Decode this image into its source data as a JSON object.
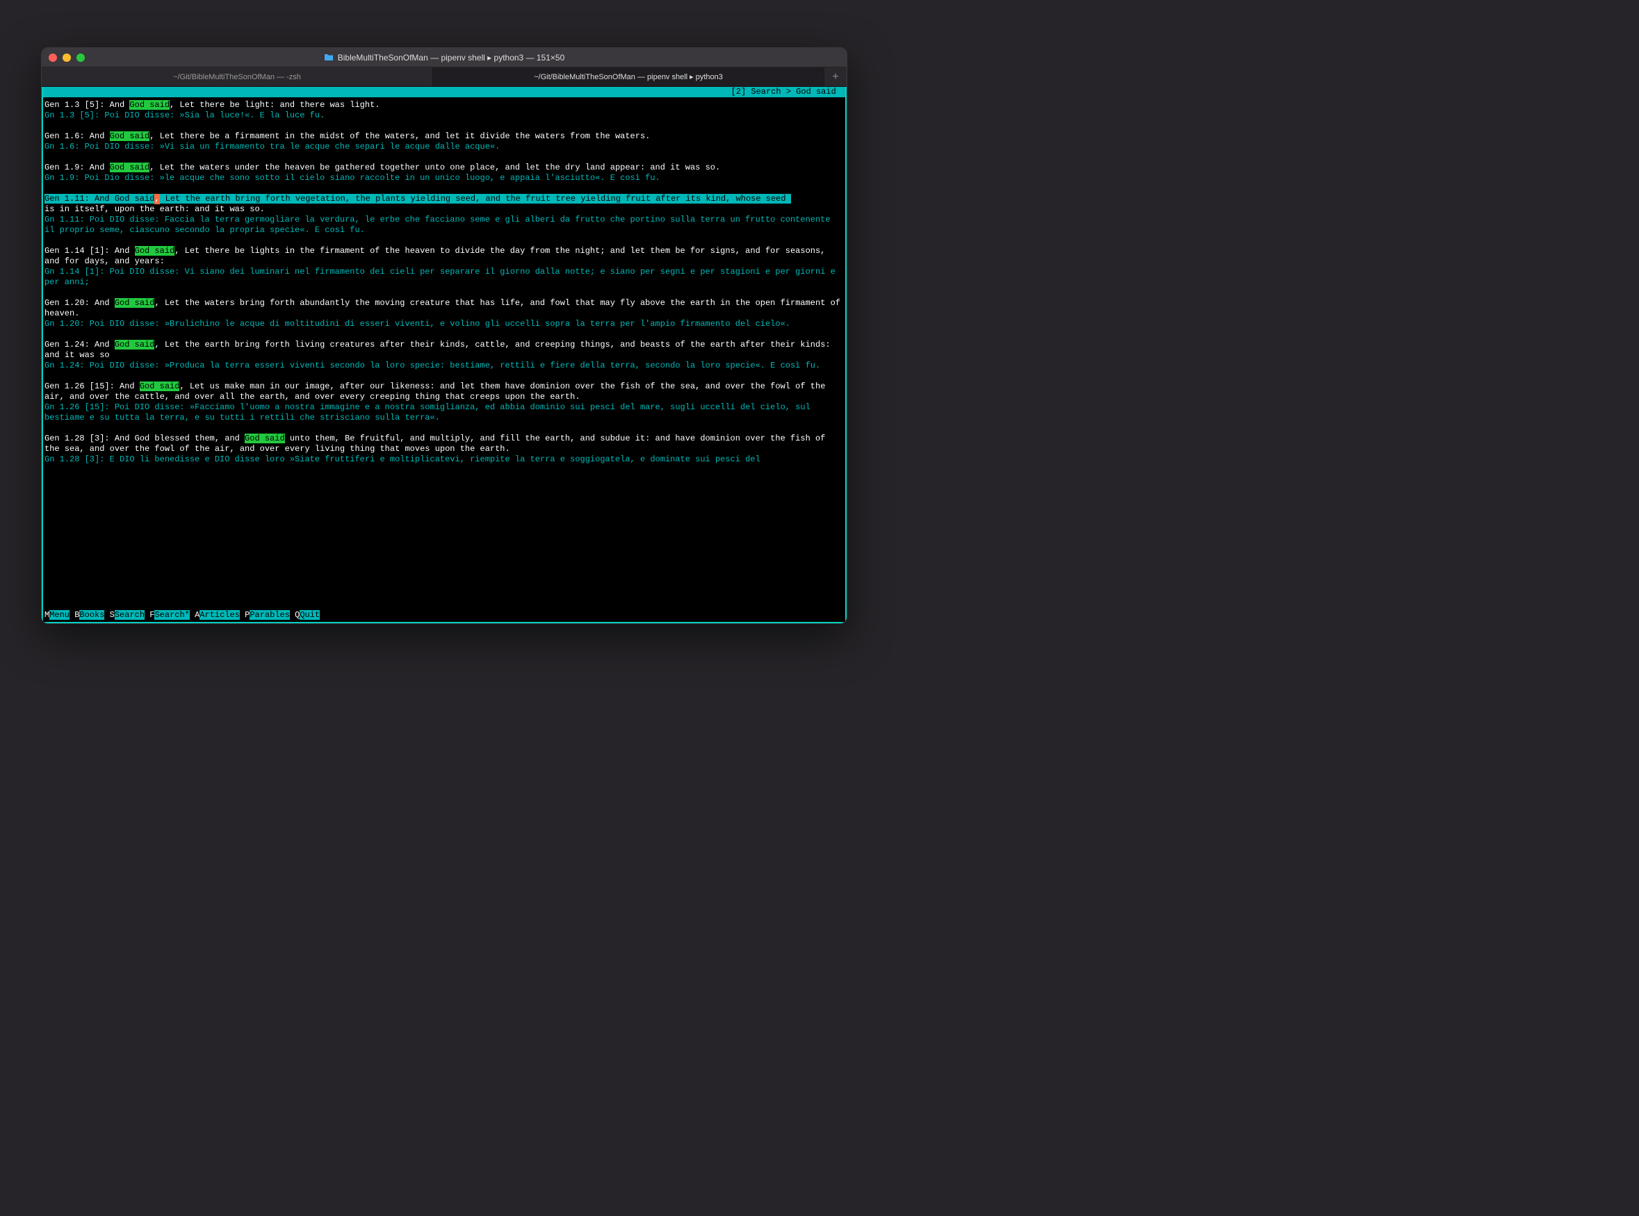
{
  "window": {
    "title": "BibleMultiTheSonOfMan — pipenv shell ▸ python3 — 151×50"
  },
  "tabs": [
    {
      "label": "~/Git/BibleMultiTheSonOfMan — -zsh",
      "active": false
    },
    {
      "label": "~/Git/BibleMultiTheSonOfMan — pipenv shell ▸ python3",
      "active": true
    }
  ],
  "topbar": "[2] Search > God said ",
  "highlight": "God said",
  "entries": [
    {
      "ref_en": "Gen 1.3 [5]: And ",
      "rest_en": ", Let there be light: and there was light.",
      "it": "Gn 1.3 [5]: Poi DIO disse: »Sia la luce!«. E la luce fu."
    },
    {
      "ref_en": "Gen 1.6: And ",
      "rest_en": ", Let there be a firmament in the midst of the waters, and let it divide the waters from the waters.",
      "it": "Gn 1.6: Poi DIO disse: »Vi sia un firmamento tra le acque che separi le acque dalle acque«."
    },
    {
      "ref_en": "Gen 1.9: And ",
      "rest_en": ", Let the waters under the heaven be gathered together unto one place, and let the dry land appear: and it was so.",
      "it": "Gn 1.9: Poi Dio disse: »le acque che sono sotto il cielo siano raccolte in un unico luogo, e appaia l'asciutto«. E così fu."
    },
    {
      "selected": true,
      "ref_en": "Gen 1.11: And ",
      "rest_en": " Let the earth bring forth vegetation, the plants yielding seed, and the fruit tree yielding fruit after its kind, whose seed ",
      "wrap_en": "is in itself, upon the earth: and it was so.",
      "it": "Gn 1.11: Poi DIO disse: Faccia la terra germogliare la verdura, le erbe che facciano seme e gli alberi da frutto che portino sulla terra un frutto contenente il proprio seme, ciascuno secondo la propria specie«. E così fu."
    },
    {
      "ref_en": "Gen 1.14 [1]: And ",
      "rest_en": ", Let there be lights in the firmament of the heaven to divide the day from the night; and let them be for signs, and for seasons, and for days, and years:",
      "it": "Gn 1.14 [1]: Poi DIO disse: Vi siano dei luminari nel firmamento dei cieli per separare il giorno dalla notte; e siano per segni e per stagioni e per giorni e per anni;"
    },
    {
      "ref_en": "Gen 1.20: And ",
      "rest_en": ", Let the waters bring forth abundantly the moving creature that has life, and fowl that may fly above the earth in the open firmament of heaven.",
      "it": "Gn 1.20: Poi DIO disse: »Brulichino le acque di moltitudini di esseri viventi, e volino gli uccelli sopra la terra per l'ampio firmamento del cielo«."
    },
    {
      "ref_en": "Gen 1.24: And ",
      "rest_en": ", Let the earth bring forth living creatures after their kinds, cattle, and creeping things, and beasts of the earth after their kinds: and it was so",
      "it": "Gn 1.24: Poi DIO disse: »Produca la terra esseri viventi secondo la loro specie: bestiame, rettili e fiere della terra, secondo la loro specie«. E così fu."
    },
    {
      "ref_en": "Gen 1.26 [15]: And ",
      "rest_en": ", Let us make man in our image, after our likeness: and let them have dominion over the fish of the sea, and over the fowl of the air, and over the cattle, and over all the earth, and over every creeping thing that creeps upon the earth.",
      "it": "Gn 1.26 [15]: Poi DIO disse: »Facciamo l'uomo a nostra immagine e a nostra somiglianza, ed abbia dominio sui pesci del mare, sugli uccelli del cielo, sul bestiame e su tutta la terra, e su tutti i rettili che strisciano sulla terra«."
    },
    {
      "ref_en": "Gen 1.28 [3]: And God blessed them, and ",
      "rest_en": " unto them, Be fruitful, and multiply, and fill the earth, and subdue it: and have dominion over the fish of the sea, and over the fowl of the air, and over every living thing that moves upon the earth.",
      "it": "Gn 1.28 [3]: E DIO li benedisse e DIO disse loro »Siate fruttiferi e moltiplicatevi, riempite la terra e soggiogatela, e dominate sui pesci del"
    }
  ],
  "menu": [
    {
      "key": "M",
      "label": "Menu"
    },
    {
      "key": "B",
      "label": "Books"
    },
    {
      "key": "S",
      "label": "Search"
    },
    {
      "key": "F",
      "label": "Search*"
    },
    {
      "key": "A",
      "label": "Articles"
    },
    {
      "key": "P",
      "label": "Parables"
    },
    {
      "key": "Q",
      "label": "Quit"
    }
  ]
}
